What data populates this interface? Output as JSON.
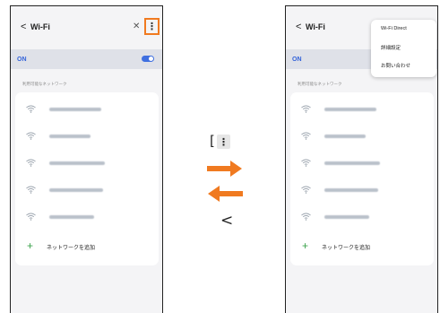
{
  "wifi": {
    "back": "<",
    "title": "Wi-Fi",
    "scan_icon": "⌘",
    "more_icon": "⋮",
    "on_label": "ON",
    "section_label": "利用可能なネットワーク",
    "add_network": "ネットワークを追加",
    "plus": "+"
  },
  "popup": {
    "items": [
      "Wi-Fi Direct",
      "詳細設定",
      "お問い合わせ"
    ]
  },
  "center": {
    "menu_key": "[   ]",
    "menu_key_dots": "⋮",
    "back_key": "<"
  },
  "colors": {
    "highlight": "#f07a20",
    "arrow": "#f07a20",
    "toggle": "#3f6fe0",
    "on_text": "#3463d9"
  }
}
